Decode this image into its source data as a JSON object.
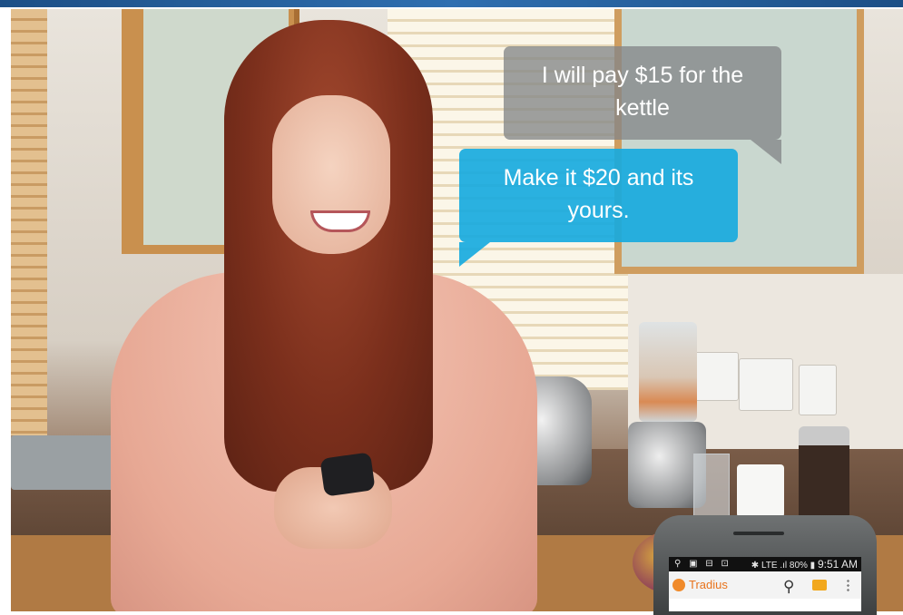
{
  "chat": {
    "buyer_message": "I will pay $15 for the kettle",
    "seller_message": "Make it $20 and its yours."
  },
  "phone": {
    "status": {
      "left_icons": "⚲ ▣ ⊟ ⊡",
      "right_text": "✱ LTE .ıl 80% ▮ ",
      "time": "9:51 AM"
    },
    "app": {
      "name": "Tradius",
      "search_icon": "search-icon",
      "camera_icon": "camera-icon",
      "menu_icon": "menu-icon"
    }
  },
  "colors": {
    "buyer_bubble": "#848688",
    "seller_bubble": "#18aade",
    "brand_orange": "#e8731c",
    "top_bar": "#2f6fb0"
  }
}
